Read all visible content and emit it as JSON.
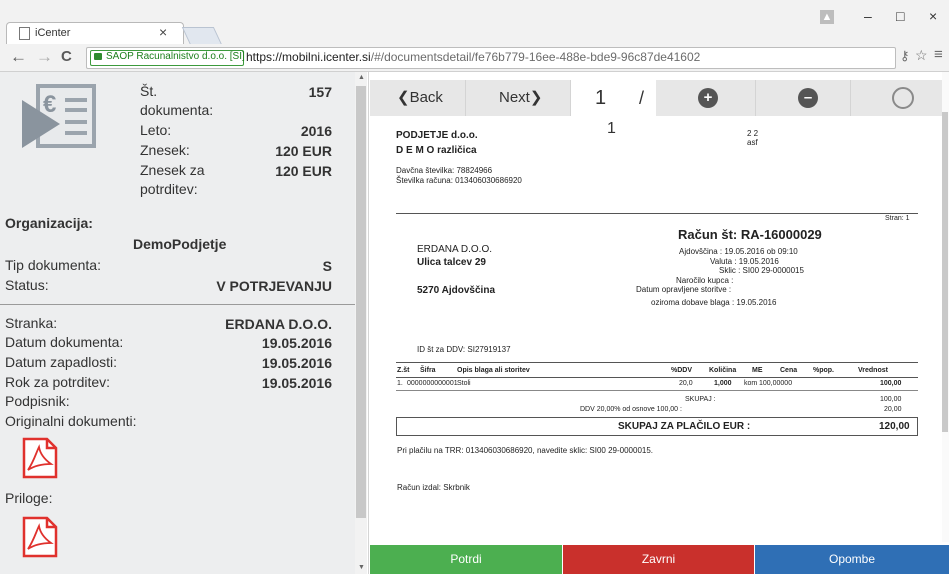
{
  "browser": {
    "tab_title": "iCenter",
    "tab_close": "×",
    "nav_back": "←",
    "nav_forward": "→",
    "nav_reload": "C",
    "ssl_label": "SAOP Racunalnistvo d.o.o. [SI]",
    "url_host": "https://mobilni.icenter.si",
    "url_path": "/#/documentsdetail/fe76b779-16ee-488e-bde9-96c87de41602",
    "win_minimize": "–",
    "win_maximize": "□",
    "win_close": "×",
    "menu_icon": "≡"
  },
  "summary": {
    "st_label_1": "Št.",
    "st_label_2": "dokumenta:",
    "st_value": "157",
    "leto_label": "Leto:",
    "leto_value": "2016",
    "znesek_label": "Znesek:",
    "znesek_value": "120 EUR",
    "znesek_za_label_1": "Znesek za",
    "znesek_za_label_2": "potrditev:",
    "znesek_za_value": "120 EUR"
  },
  "details": {
    "organizacija_label": "Organizacija:",
    "organizacija_value": "DemoPodjetje",
    "tip_label": "Tip dokumenta:",
    "tip_value": "S",
    "status_label": "Status:",
    "status_value": "V POTRJEVANJU",
    "stranka_label": "Stranka:",
    "stranka_value": "ERDANA D.O.O.",
    "datum_label": "Datum dokumenta:",
    "datum_value": "19.05.2016",
    "zapadlost_label": "Datum zapadlosti:",
    "zapadlost_value": "19.05.2016",
    "rok_label": "Rok za potrditev:",
    "rok_value": "19.05.2016",
    "podpisnik_label": "Podpisnik:",
    "originalni_label": "Originalni dokumenti:",
    "priloge_label": "Priloge:"
  },
  "viewer": {
    "back_label": "❮Back",
    "next_label": "Next❯",
    "page_current": "1",
    "page_sep": "/",
    "page_total": "1",
    "zoom_in": "+",
    "zoom_out": "–"
  },
  "invoice": {
    "company": "PODJETJE d.o.o.",
    "company_sub": "D E M O  različica",
    "tax_no": "Davčna številka:  78824966",
    "account_no": "Številka računa:  013406030686920",
    "right_1": "2 2",
    "right_2": "asf",
    "stran": "Stran:  1",
    "title": "Račun št:  RA-16000029",
    "buyer_name": "ERDANA D.O.O.",
    "buyer_street": "Ulica talcev 29",
    "buyer_city": "5270 Ajdovščina",
    "meta_1": "Ajdovščina :  19.05.2016 ob 09:10",
    "meta_2": "Valuta :  19.05.2016",
    "meta_3": "Sklic :  SI00 29-0000015",
    "meta_4": "Naročilo kupca :",
    "meta_5": "Datum opravljene storitve :",
    "meta_6": "oziroma dobave blaga :  19.05.2016",
    "vat_id": "ID št za DDV:  SI27919137",
    "headers": [
      "Z.št",
      "Šifra",
      "Opis blaga ali storitev",
      "%DDV",
      "Količina",
      "ME",
      "Cena",
      "%pop.",
      "Vrednost"
    ],
    "row": [
      "1.",
      "0000000000001",
      "Stoli",
      "20,0",
      "1,000",
      "kom",
      "100,00000",
      "",
      "100,00"
    ],
    "skupaj_label": "SKUPAJ :",
    "skupaj_value": "100,00",
    "ddv_label": "DDV 20,00%  od osnove 100,00 :",
    "ddv_value": "20,00",
    "total_label": "SKUPAJ ZA PLAČILO EUR :",
    "total_value": "120,00",
    "payment_note": "Pri plačilu na TRR: 013406030686920, navedite sklic: SI00 29-0000015.",
    "issued_by": "Račun izdal:   Skrbnik"
  },
  "actions": {
    "potrdi": "Potrdi",
    "zavrni": "Zavrni",
    "opombe": "Opombe"
  },
  "colors": {
    "potrdi": "#4caf50",
    "zavrni": "#c9302c",
    "opombe": "#2f6fb5",
    "pdf_red": "#e0312d"
  }
}
